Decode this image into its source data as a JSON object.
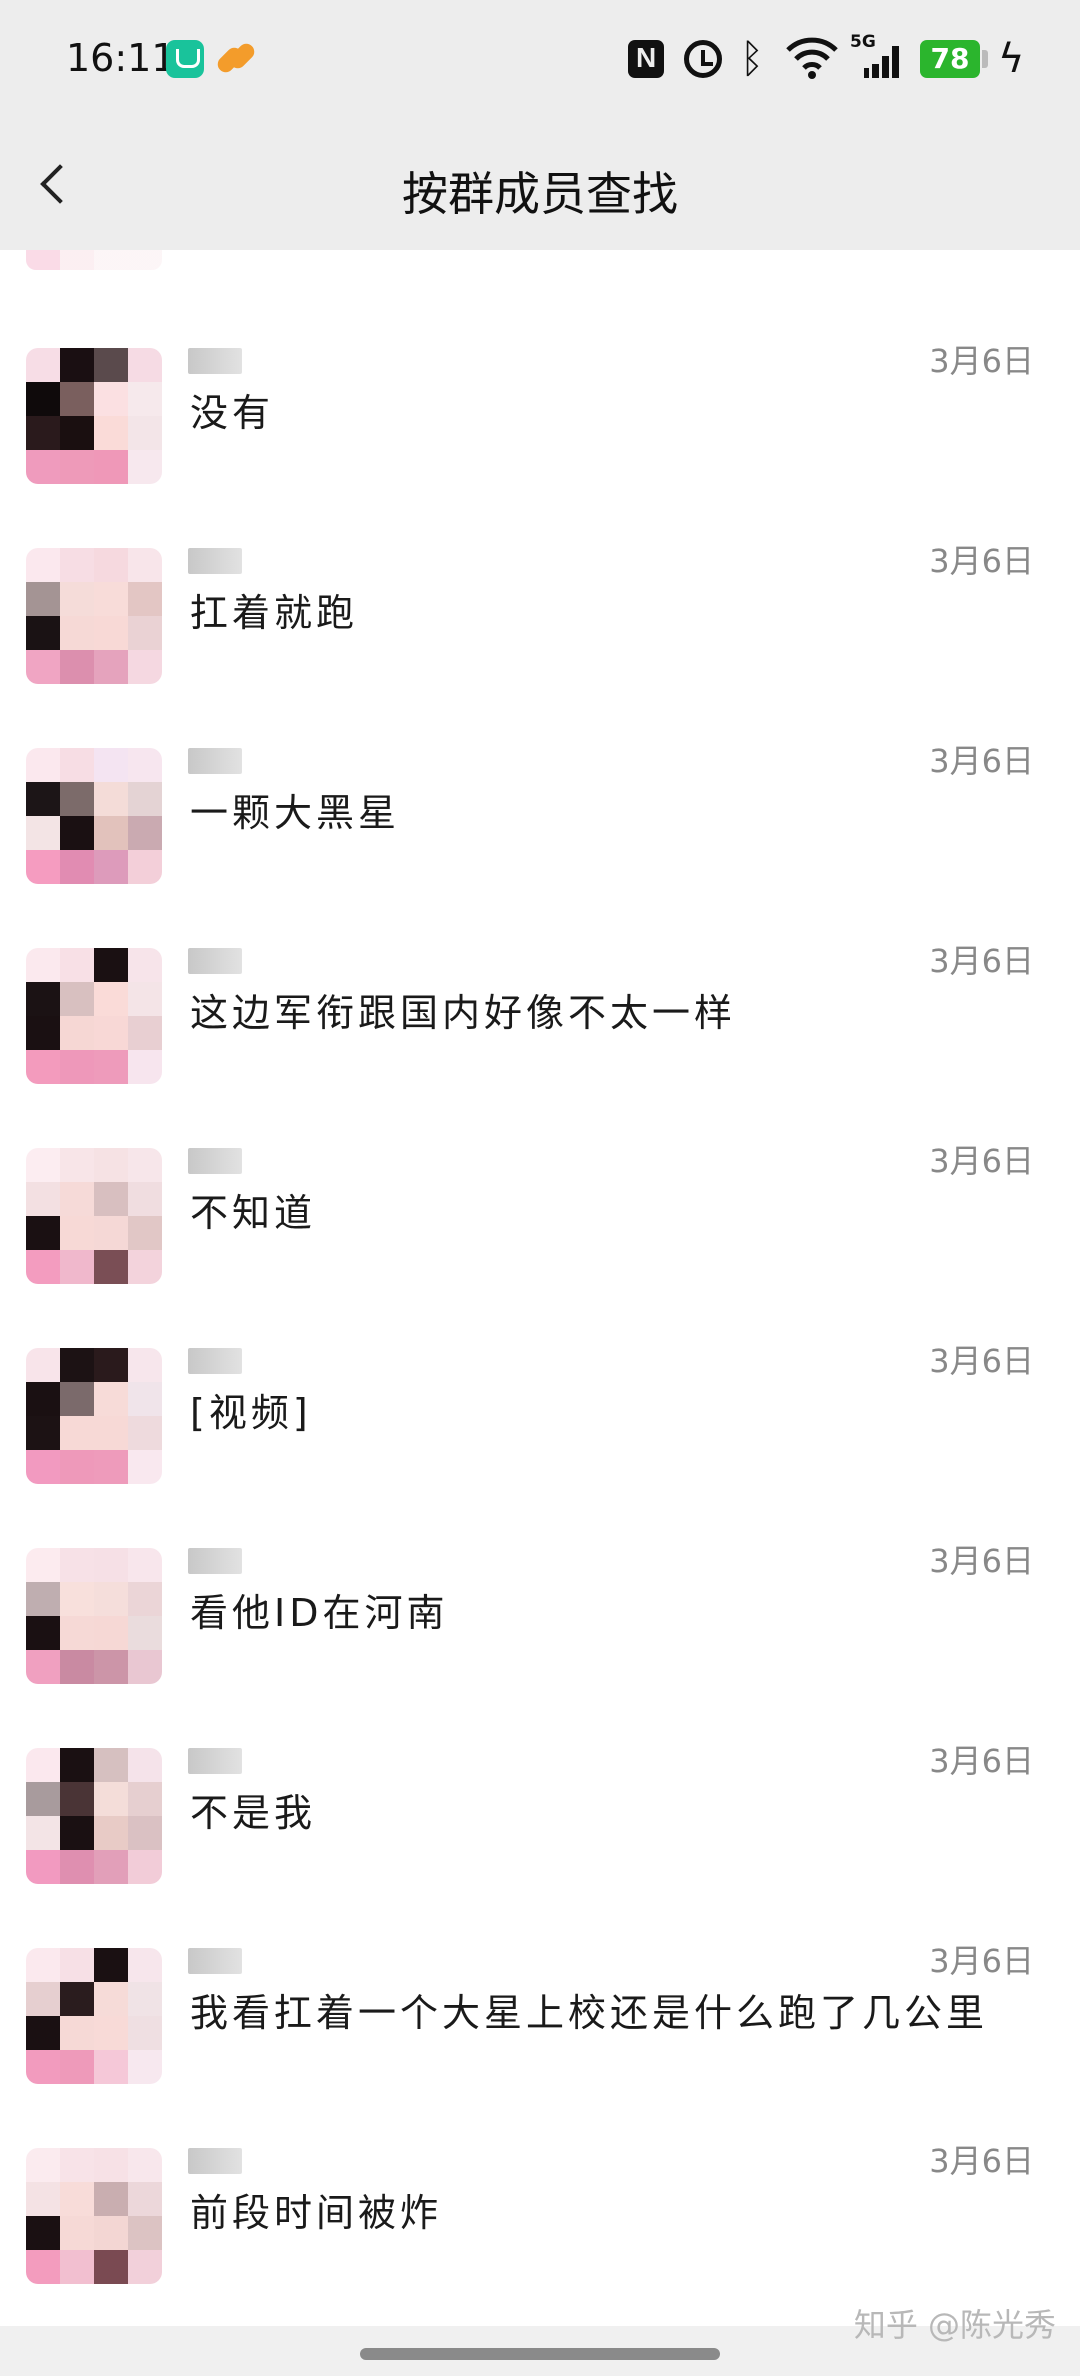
{
  "status_bar": {
    "time": "16:11",
    "network": "5G",
    "battery": "78",
    "icons": [
      "mi-home-icon",
      "app-badge-icon",
      "nfc-icon",
      "alarm-icon",
      "bluetooth-icon",
      "wifi-icon",
      "signal-icon",
      "battery-icon",
      "charging-icon"
    ]
  },
  "header": {
    "title": "按群成员查找",
    "back_icon": "chevron-left-icon"
  },
  "results": [
    {
      "message": "没有",
      "date": "3月6日"
    },
    {
      "message": "扛着就跑",
      "date": "3月6日"
    },
    {
      "message": "一颗大黑星",
      "date": "3月6日"
    },
    {
      "message": "这边军衔跟国内好像不太一样",
      "date": "3月6日"
    },
    {
      "message": "不知道",
      "date": "3月6日"
    },
    {
      "message": "[视频]",
      "date": "3月6日"
    },
    {
      "message": "看他ID在河南",
      "date": "3月6日"
    },
    {
      "message": "不是我",
      "date": "3月6日"
    },
    {
      "message": "我看扛着一个大星上校还是什么跑了几公里",
      "date": "3月6日"
    },
    {
      "message": "前段时间被炸",
      "date": "3月6日"
    }
  ],
  "watermark": "知乎 @陈光秀"
}
